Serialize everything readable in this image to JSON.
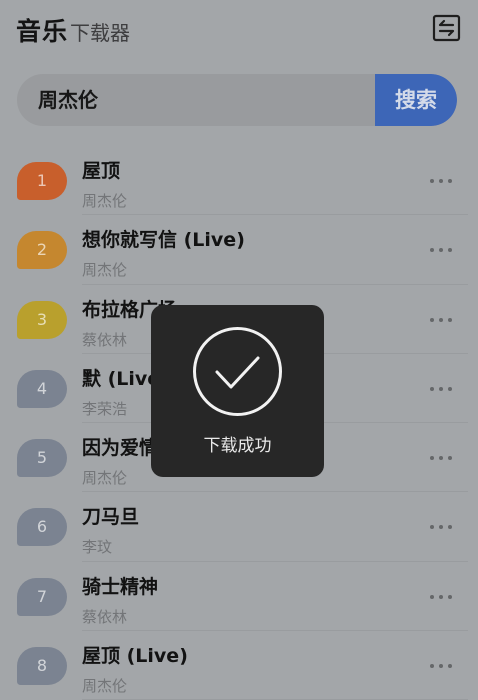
{
  "header": {
    "title": "音乐",
    "subtitle": "下载器",
    "switch_icon": "swap-horizontal-icon"
  },
  "search": {
    "value": "周杰伦",
    "button_label": "搜索"
  },
  "songs": [
    {
      "rank": "1",
      "title": "屋顶",
      "artist": "周杰伦",
      "color": "#c85f2c"
    },
    {
      "rank": "2",
      "title": "想你就写信 (Live)",
      "artist": "周杰伦",
      "color": "#c5872f"
    },
    {
      "rank": "3",
      "title": "布拉格广场",
      "artist": "蔡依林",
      "color": "#b9a02d"
    },
    {
      "rank": "4",
      "title": "默 (Live)",
      "artist": "李荣浩",
      "color": "#7b8391"
    },
    {
      "rank": "5",
      "title": "因为爱情",
      "artist": "周杰伦",
      "color": "#7b8391"
    },
    {
      "rank": "6",
      "title": "刀马旦",
      "artist": "李玟",
      "color": "#7b8391"
    },
    {
      "rank": "7",
      "title": "骑士精神",
      "artist": "蔡依林",
      "color": "#7b8391"
    },
    {
      "rank": "8",
      "title": "屋顶 (Live)",
      "artist": "周杰伦",
      "color": "#7b8391"
    }
  ],
  "toast": {
    "message": "下载成功",
    "icon": "check-circle-icon"
  }
}
